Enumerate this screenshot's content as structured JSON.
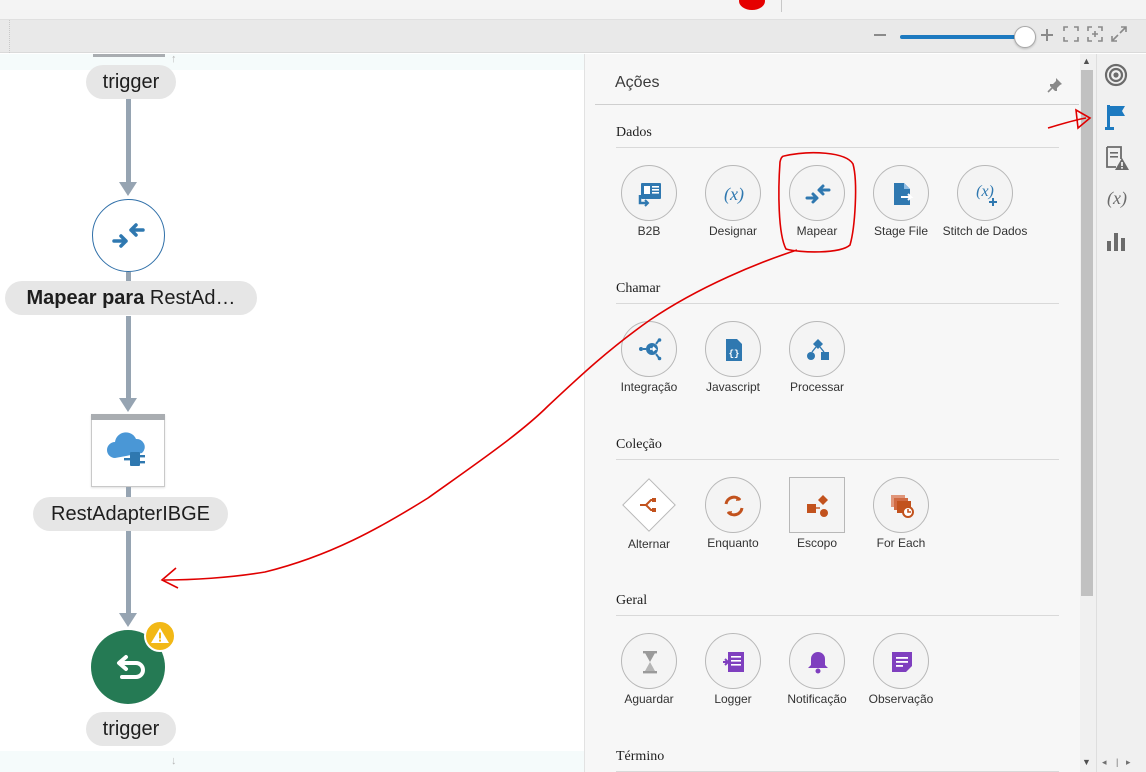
{
  "panel": {
    "title": "Ações",
    "sections": [
      {
        "title": "Dados",
        "items": [
          {
            "label": "B2B",
            "icon": "b2b-icon"
          },
          {
            "label": "Designar",
            "icon": "assign-icon"
          },
          {
            "label": "Mapear",
            "icon": "map-icon"
          },
          {
            "label": "Stage File",
            "icon": "stage-file-icon"
          },
          {
            "label": "Stitch de Dados",
            "icon": "data-stitch-icon"
          }
        ]
      },
      {
        "title": "Chamar",
        "items": [
          {
            "label": "Integração",
            "icon": "integration-icon"
          },
          {
            "label": "Javascript",
            "icon": "javascript-icon"
          },
          {
            "label": "Processar",
            "icon": "process-icon"
          }
        ]
      },
      {
        "title": "Coleção",
        "items": [
          {
            "label": "Alternar",
            "icon": "switch-icon"
          },
          {
            "label": "Enquanto",
            "icon": "while-icon"
          },
          {
            "label": "Escopo",
            "icon": "scope-icon"
          },
          {
            "label": "For Each",
            "icon": "for-each-icon"
          }
        ]
      },
      {
        "title": "Geral",
        "items": [
          {
            "label": "Aguardar",
            "icon": "wait-icon"
          },
          {
            "label": "Logger",
            "icon": "logger-icon"
          },
          {
            "label": "Notificação",
            "icon": "notification-icon"
          },
          {
            "label": "Observação",
            "icon": "note-icon"
          }
        ]
      },
      {
        "title": "Término",
        "items": []
      }
    ]
  },
  "canvas": {
    "top_trigger_label": "trigger",
    "map_node_bold": "Mapear para",
    "map_node_rest": "RestAd…",
    "rest_node_label": "RestAdapterIBGE",
    "bottom_trigger_label": "trigger"
  },
  "colors": {
    "accent_blue": "#1d7ac0",
    "dados_icon": "#2f78b0",
    "chamar_icon": "#2f78b0",
    "colecao_icon": "#c2521d",
    "geral_gray": "#9a9a9a",
    "geral_purple": "#7f3fbf",
    "return_node": "#257a54",
    "warning": "#f2b816",
    "annotation": "#e00000"
  }
}
